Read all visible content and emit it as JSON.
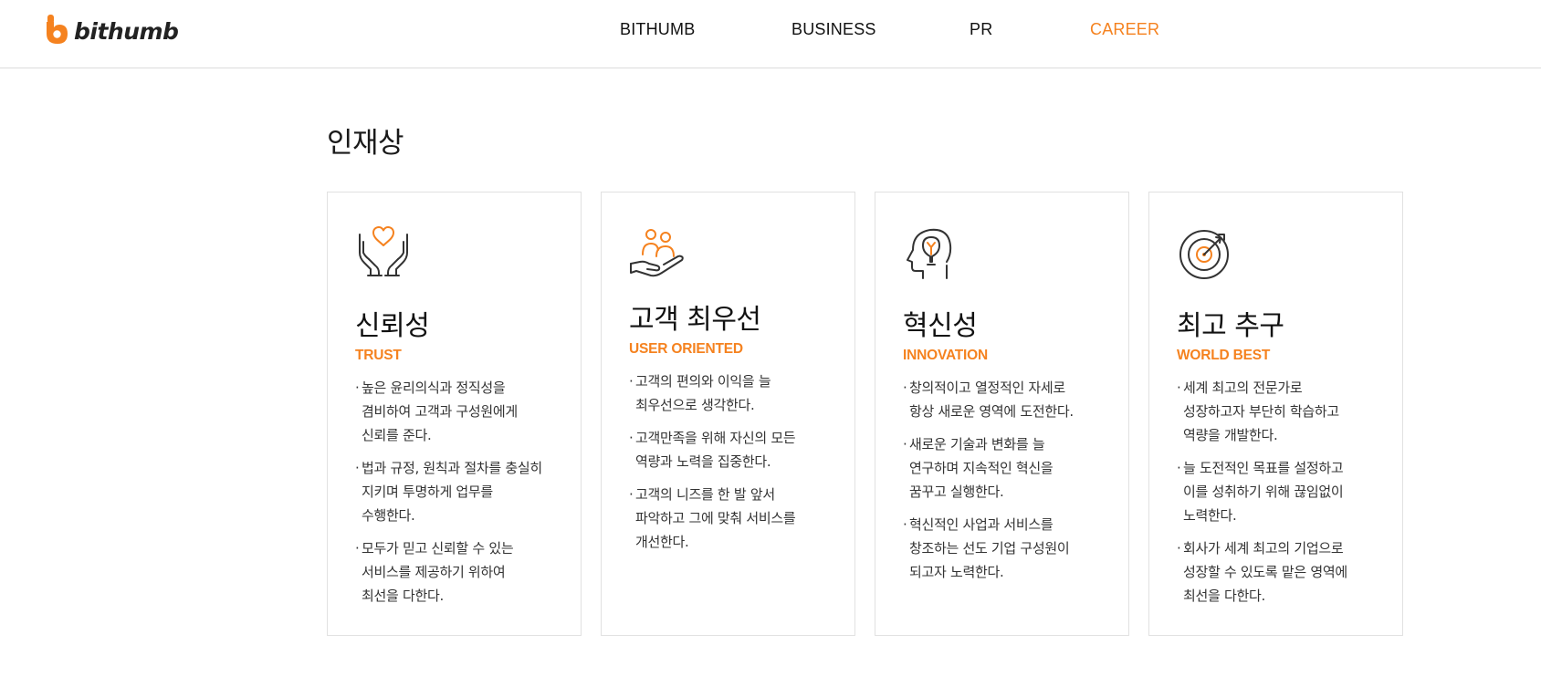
{
  "header": {
    "logo_text": "bithumb",
    "nav": [
      {
        "label": "BITHUMB",
        "active": false
      },
      {
        "label": "BUSINESS",
        "active": false
      },
      {
        "label": "PR",
        "active": false
      },
      {
        "label": "CAREER",
        "active": true
      }
    ]
  },
  "colors": {
    "accent": "#f5821f",
    "text": "#1a1a1a",
    "border": "#e1e1e1"
  },
  "section": {
    "title": "인재상",
    "cards": [
      {
        "icon": "hands-heart-icon",
        "title": "신뢰성",
        "subtitle": "TRUST",
        "items": [
          "높은 윤리의식과 정직성을\n겸비하여 고객과 구성원에게\n신뢰를 준다.",
          "법과 규정, 원칙과 절차를 충실히\n지키며 투명하게 업무를\n수행한다.",
          "모두가 믿고 신뢰할 수 있는\n서비스를 제공하기 위하여\n최선을 다한다."
        ]
      },
      {
        "icon": "customer-hand-icon",
        "title": "고객 최우선",
        "subtitle": "USER ORIENTED",
        "items": [
          "고객의 편의와 이익을 늘\n최우선으로 생각한다.",
          "고객만족을 위해 자신의 모든\n역량과 노력을 집중한다.",
          "고객의 니즈를 한 발 앞서\n파악하고 그에 맞춰 서비스를\n개선한다."
        ]
      },
      {
        "icon": "head-bulb-icon",
        "title": "혁신성",
        "subtitle": "INNOVATION",
        "items": [
          "창의적이고 열정적인 자세로\n항상 새로운 영역에 도전한다.",
          "새로운 기술과 변화를 늘\n연구하며 지속적인 혁신을\n꿈꾸고 실행한다.",
          "혁신적인 사업과 서비스를\n창조하는 선도 기업 구성원이\n되고자 노력한다."
        ]
      },
      {
        "icon": "target-icon",
        "title": "최고 추구",
        "subtitle": "WORLD BEST",
        "items": [
          "세계 최고의 전문가로\n성장하고자 부단히 학습하고\n역량을 개발한다.",
          "늘 도전적인 목표를 설정하고\n이를 성취하기 위해 끊임없이\n노력한다.",
          "회사가 세계 최고의 기업으로\n성장할 수 있도록 맡은 영역에\n최선을 다한다."
        ]
      }
    ]
  }
}
